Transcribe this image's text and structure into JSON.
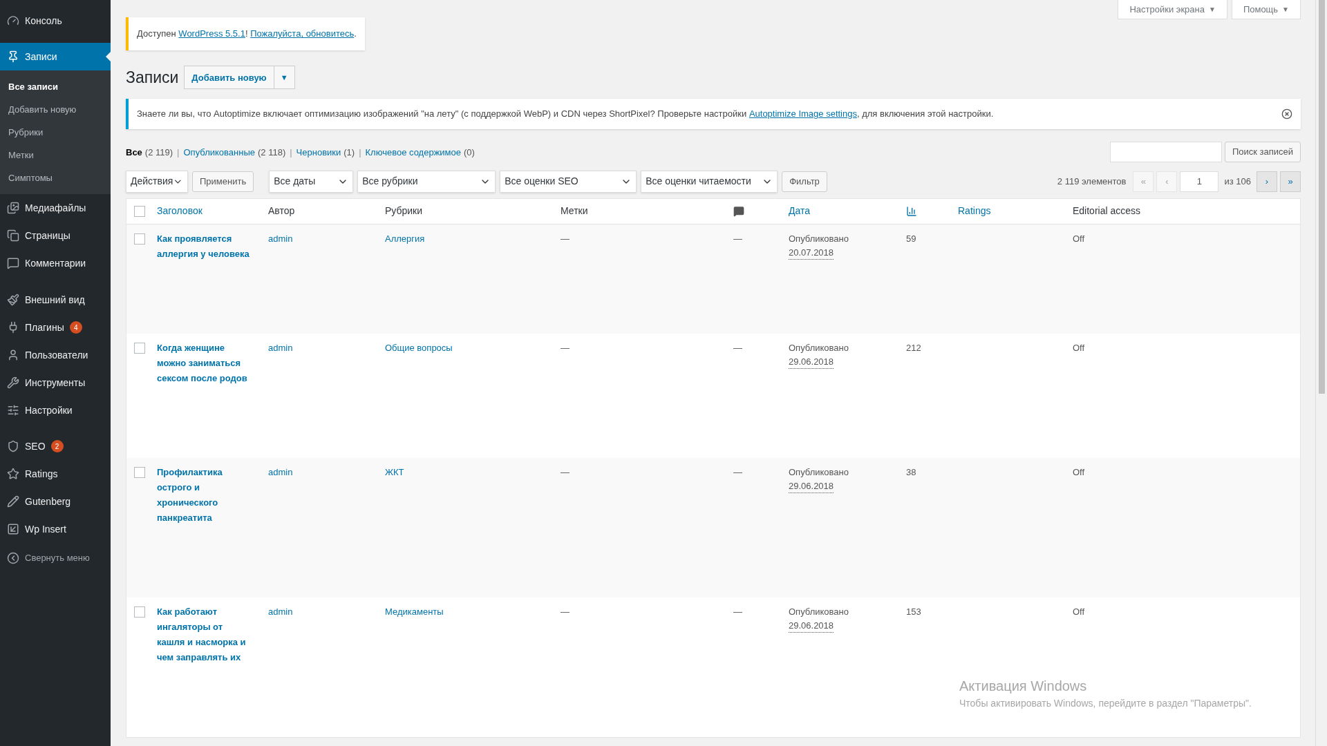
{
  "top_buttons": [
    {
      "label": "Настройки экрана",
      "caret": "▼"
    },
    {
      "label": "Помощь",
      "caret": "▼"
    }
  ],
  "sidebar": {
    "items": [
      {
        "label": "Консоль",
        "selected": false
      },
      {
        "label": "Записи",
        "selected": true,
        "children": [
          {
            "label": "Все записи",
            "selected": true
          },
          {
            "label": "Добавить новую",
            "selected": false
          },
          {
            "label": "Рубрики",
            "selected": false
          },
          {
            "label": "Метки",
            "selected": false
          },
          {
            "label": "Симптомы",
            "selected": false
          }
        ]
      },
      {
        "label": "Медиафайлы",
        "selected": false
      },
      {
        "label": "Страницы",
        "selected": false
      },
      {
        "label": "Комментарии",
        "selected": false
      },
      {
        "label": "Внешний вид",
        "selected": false
      },
      {
        "label": "Плагины",
        "selected": false,
        "badge": "4"
      },
      {
        "label": "Пользователи",
        "selected": false
      },
      {
        "label": "Инструменты",
        "selected": false
      },
      {
        "label": "Настройки",
        "selected": false
      },
      {
        "label": "SEO",
        "selected": false,
        "badge": "2"
      },
      {
        "label": "Ratings",
        "selected": false
      },
      {
        "label": "Gutenberg",
        "selected": false
      },
      {
        "label": "Wp Insert",
        "selected": false
      }
    ],
    "collapse": "Свернуть меню"
  },
  "update_notice": [
    {
      "kind": "text",
      "text": "Доступен "
    },
    {
      "kind": "link",
      "text": "WordPress 5.5.1"
    },
    {
      "kind": "text",
      "text": "! "
    },
    {
      "kind": "link",
      "text": "Пожалуйста, обновитесь"
    },
    {
      "kind": "text",
      "text": "."
    }
  ],
  "page_title": "Записи",
  "add_new_button": "Добавить новую",
  "add_new_menu": "▼",
  "info_notice": [
    {
      "kind": "text",
      "text": "Знаете ли вы, что Autoptimize включает оптимизацию изображений \"на лету\" (с поддержкой WebP) и CDN через ShortPixel? Проверьте настройки "
    },
    {
      "kind": "link",
      "text": "Autoptimize Image settings"
    },
    {
      "kind": "text",
      "text": ", для включения этой настройки."
    }
  ],
  "status_filters": [
    {
      "label": "Все",
      "count": "(2 119)",
      "selected": true
    },
    {
      "separator": "|",
      "label": "Опубликованные",
      "count": "(2 118)",
      "selected": false
    },
    {
      "separator": "|",
      "label": "Черновики",
      "count": "(1)",
      "selected": false
    },
    {
      "separator": "|",
      "label": "Ключевое содержимое",
      "count": "(0)",
      "selected": false
    }
  ],
  "search": {
    "button": "Поиск записей"
  },
  "bulk_action": {
    "value": "Действия",
    "apply": "Применить"
  },
  "filter_selects": [
    "Все даты",
    "Все рубрики",
    "Все оценки SEO",
    "Все оценки читаемости"
  ],
  "filter_button": "Фильтр",
  "pagination": {
    "count": "2 119 элементов",
    "buttons": [
      {
        "label": "«",
        "disabled": true
      },
      {
        "label": "‹",
        "disabled": true
      }
    ],
    "page": "1",
    "of": "из 106",
    "next_buttons": [
      {
        "label": "›",
        "disabled": false
      },
      {
        "label": "»",
        "disabled": false
      }
    ]
  },
  "table": {
    "select_all_checked": false,
    "columns": [
      {
        "kind": "text",
        "label": "Заголовок",
        "sortable": true
      },
      {
        "kind": "text",
        "label": "Автор",
        "sortable": false
      },
      {
        "kind": "text",
        "label": "Рубрики",
        "sortable": false
      },
      {
        "kind": "text",
        "label": "Метки",
        "sortable": false
      },
      {
        "kind": "icon",
        "sortable": false
      },
      {
        "kind": "text",
        "label": "Дата",
        "sortable": true
      },
      {
        "kind": "icon",
        "sortable": true
      },
      {
        "kind": "text",
        "label": "Ratings",
        "sortable": true
      },
      {
        "kind": "text",
        "label": "Editorial access",
        "sortable": false
      }
    ],
    "rows": [
      {
        "checked": false,
        "title": "Как проявляется аллергия у человека",
        "author": "admin",
        "category": "Аллергия",
        "tags": "—",
        "comments": "—",
        "status": "Опубликовано",
        "date": "20.07.2018",
        "count": "59",
        "editorial": "Off"
      },
      {
        "checked": false,
        "title": "Когда женщине можно заниматься сексом после родов",
        "author": "admin",
        "category": "Общие вопросы",
        "tags": "—",
        "comments": "—",
        "status": "Опубликовано",
        "date": "29.06.2018",
        "count": "212",
        "editorial": "Off"
      },
      {
        "checked": false,
        "title": "Профилактика острого и хронического панкреатита",
        "author": "admin",
        "category": "ЖКТ",
        "tags": "—",
        "comments": "—",
        "status": "Опубликовано",
        "date": "29.06.2018",
        "count": "38",
        "editorial": "Off"
      },
      {
        "checked": false,
        "title": "Как работают ингаляторы от кашля и насморка и чем заправлять их",
        "author": "admin",
        "category": "Медикаменты",
        "tags": "—",
        "comments": "—",
        "status": "Опубликовано",
        "date": "29.06.2018",
        "count": "153",
        "editorial": "Off"
      }
    ]
  },
  "windows_activation": {
    "title": "Активация Windows",
    "text": "Чтобы активировать Windows, перейдите в раздел \"Параметры\"."
  }
}
